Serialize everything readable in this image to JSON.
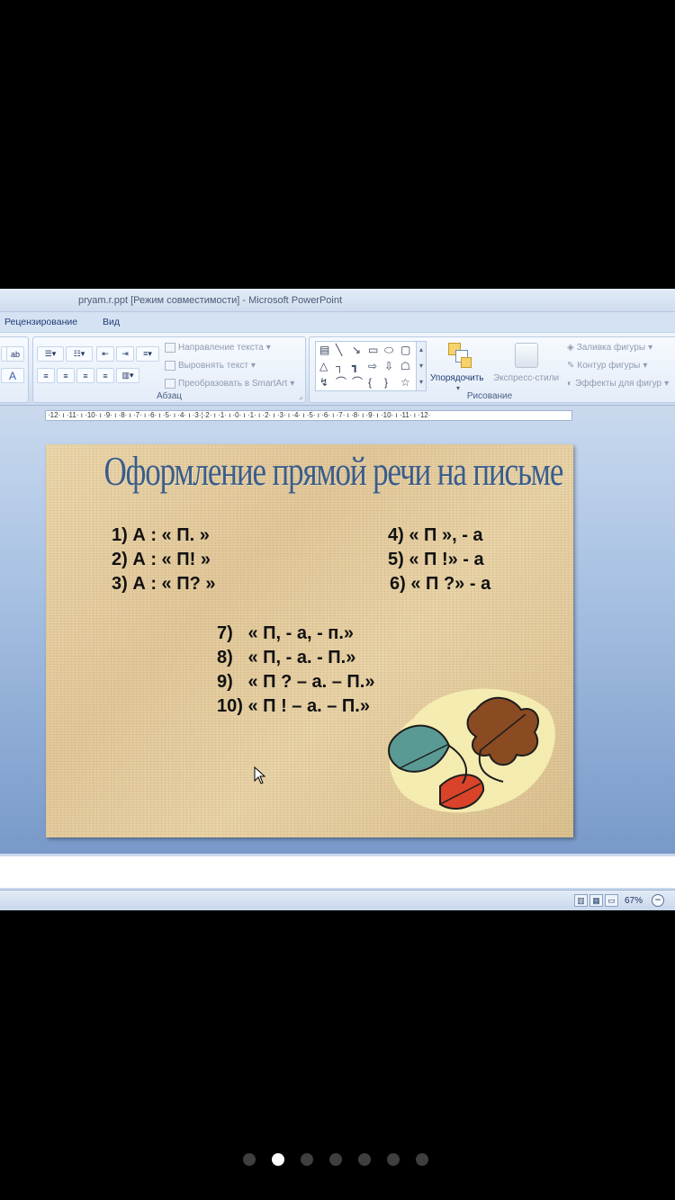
{
  "window": {
    "title": "pryam.r.ppt [Режим совместимости] - Microsoft PowerPoint"
  },
  "tabs": [
    {
      "label": "Рецензирование"
    },
    {
      "label": "Вид"
    }
  ],
  "ribbon": {
    "paragraph_group": {
      "label": "Абзац",
      "commands": {
        "text_direction": "Направление текста",
        "align_text": "Выровнять текст",
        "convert_smartart": "Преобразовать в SmartArt"
      }
    },
    "drawing_group": {
      "label": "Рисование",
      "arrange_label": "Упорядочить",
      "quick_styles_label": "Экспресс-стили",
      "commands": {
        "shape_fill": "Заливка фигуры",
        "shape_outline": "Контур фигуры",
        "shape_effects": "Эффекты для фигур"
      }
    }
  },
  "ruler": {
    "text": "·12· ı ·11· ı ·10· ı ·9· ı ·8· ı ·7· ı ·6· ı ·5· ı ·4· ı ·3·¦·2· ı ·1· ı ·0· ı ·1· ı ·2· ı ·3· ı ·4· ı ·5· ı ·6· ı ·7· ı ·8· ı ·9· ı ·10· ı ·11· ı ·12·"
  },
  "slide": {
    "title": "Оформление прямой речи на письме",
    "rules_left": [
      "1) А : « П. »",
      "2) А : « П! »",
      "3) А : « П? »"
    ],
    "rules_right": [
      "4) « П », - а",
      "5) « П !» - а",
      "6) « П ?» - а"
    ],
    "rules_bottom": [
      "7)   « П, - а, - п.»",
      "8)   « П, - а. - П.»",
      "9)   « П ? – а. – П.»",
      "10) « П ! – а. – П.»"
    ]
  },
  "status": {
    "zoom": "67%"
  },
  "pager": {
    "count": 7,
    "active_index": 1
  },
  "colors": {
    "title_blue": "#3a5d8a",
    "slide_bg": "#e6cfa2",
    "ribbon_text": "#1f3c72"
  },
  "icons": [
    "arrow-pointer-icon",
    "autumn-leaves-clipart"
  ]
}
